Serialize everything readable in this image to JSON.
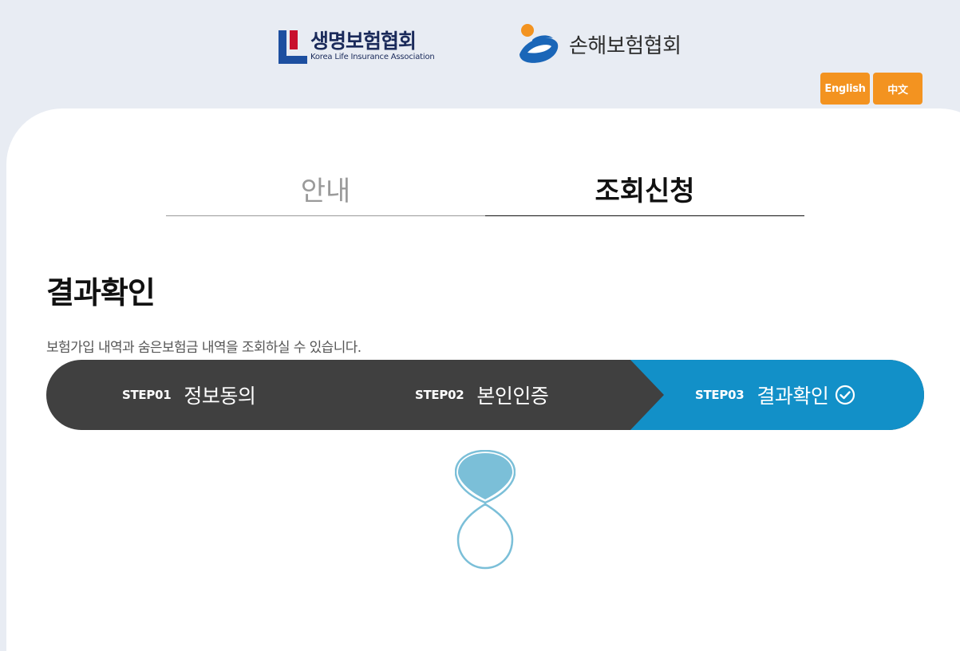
{
  "header": {
    "life_logo": {
      "kr": "생명보험협회",
      "en": "Korea Life Insurance Association"
    },
    "nonlife_logo": {
      "kr": "손해보험협회"
    },
    "languages": [
      {
        "label": "English"
      },
      {
        "label": "中文"
      }
    ]
  },
  "tabs": [
    {
      "label": "안내",
      "active": false
    },
    {
      "label": "조회신청",
      "active": true
    }
  ],
  "main": {
    "title": "결과확인",
    "description": "보험가입 내역과 숨은보험금 내역을 조회하실 수 있습니다."
  },
  "steps": [
    {
      "num": "STEP01",
      "label": "정보동의",
      "status": "done"
    },
    {
      "num": "STEP02",
      "label": "본인인증",
      "status": "done"
    },
    {
      "num": "STEP03",
      "label": "결과확인",
      "status": "current"
    }
  ],
  "colors": {
    "accent_orange": "#f39320",
    "step_active": "#1290c8",
    "step_inactive": "#404040",
    "spinner": "#7bbfd8"
  },
  "icons": {
    "check": "check-circle-icon",
    "loading": "loading-spinner-icon"
  }
}
